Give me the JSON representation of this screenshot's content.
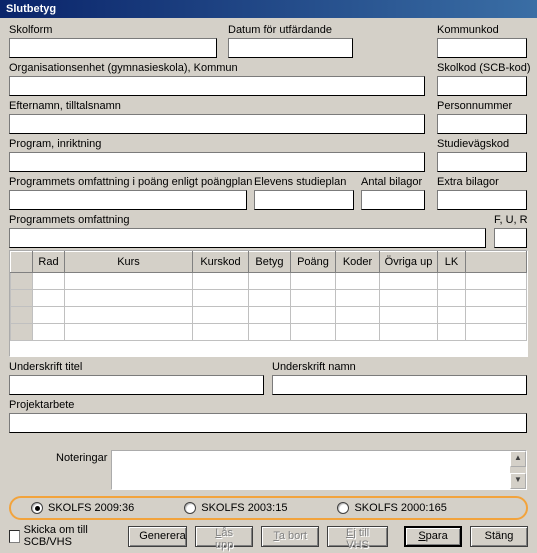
{
  "window": {
    "title": "Slutbetyg"
  },
  "labels": {
    "skolform": "Skolform",
    "datum": "Datum för utfärdande",
    "kommunkod": "Kommunkod",
    "orgenhet": "Organisationsenhet (gymnasieskola), Kommun",
    "skolkod": "Skolkod (SCB-kod)",
    "efternamn": "Efternamn, tilltalsnamn",
    "personnummer": "Personnummer",
    "program": "Program, inriktning",
    "studievagskod": "Studievägskod",
    "prog_omf_poang": "Programmets omfattning i poäng enligt poängplan",
    "elev_studieplan": "Elevens studieplan",
    "antal_bilagor": "Antal bilagor",
    "extra_bilagor": "Extra bilagor",
    "prog_omf": "Programmets omfattning",
    "fur": "F, U, R",
    "underskrift_titel": "Underskrift titel",
    "underskrift_namn": "Underskrift namn",
    "projektarbete": "Projektarbete",
    "noteringar": "Noteringar"
  },
  "values": {
    "skolform": "",
    "datum": "",
    "kommunkod": "",
    "orgenhet": "",
    "skolkod": "",
    "efternamn": "",
    "personnummer": "",
    "program": "",
    "studievagskod": "",
    "prog_omf_poang": "",
    "elev_studieplan": "",
    "antal_bilagor": "",
    "extra_bilagor": "",
    "prog_omf": "",
    "fur": "",
    "underskrift_titel": "",
    "underskrift_namn": "",
    "projektarbete": "",
    "noteringar": ""
  },
  "grid": {
    "columns": [
      "Rad",
      "Kurs",
      "Kurskod",
      "Betyg",
      "Poäng",
      "Koder",
      "Övriga up",
      "LK"
    ],
    "rows": [
      [
        "",
        "",
        "",
        "",
        "",
        "",
        "",
        ""
      ],
      [
        "",
        "",
        "",
        "",
        "",
        "",
        "",
        ""
      ],
      [
        "",
        "",
        "",
        "",
        "",
        "",
        "",
        ""
      ],
      [
        "",
        "",
        "",
        "",
        "",
        "",
        "",
        ""
      ]
    ]
  },
  "radios": {
    "options": [
      "SKOLFS 2009:36",
      "SKOLFS 2003:15",
      "SKOLFS 2000:165"
    ],
    "selected": 0
  },
  "footer": {
    "checkbox_label": "Skicka om till SCB/VHS",
    "checkbox_checked": false,
    "buttons": {
      "generera": "Generera",
      "lasupp": "Lås upp",
      "tabort": "Ta bort",
      "ejtillvhs": "Ej till VHS",
      "spara": "Spara",
      "stang": "Stäng"
    }
  }
}
